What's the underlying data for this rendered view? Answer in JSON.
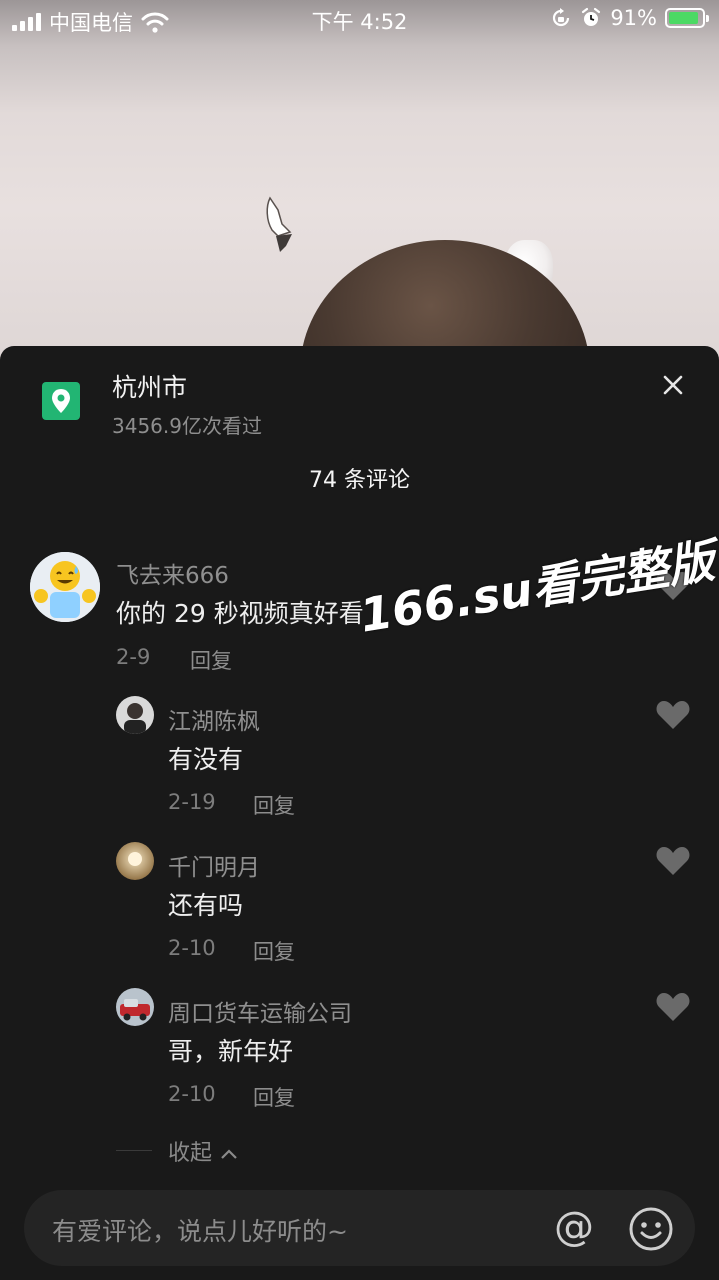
{
  "status_bar": {
    "carrier": "中国电信",
    "time": "下午 4:52",
    "battery_percent": "91%",
    "battery_level": 0.91
  },
  "location": {
    "title": "杭州市",
    "views": "3456.9亿次看过"
  },
  "comment_count": "74 条评论",
  "comments": [
    {
      "username": "飞去来666",
      "text": "你的 29 秒视频真好看",
      "date": "2-9",
      "reply_label": "回复",
      "avatar": "emoji-avatar"
    },
    {
      "username": "江湖陈枫",
      "text": "有没有",
      "date": "2-19",
      "reply_label": "回复",
      "avatar": "man-avatar"
    },
    {
      "username": "千门明月",
      "text": "还有吗",
      "date": "2-10",
      "reply_label": "回复",
      "avatar": "warm-avatar"
    },
    {
      "username": "周口货车运输公司",
      "text": "哥，新年好",
      "date": "2-10",
      "reply_label": "回复",
      "avatar": "truck-avatar"
    }
  ],
  "collapse_label": "收起",
  "watermark": "166.su看完整版",
  "input": {
    "placeholder": "有爱评论，说点儿好听的~",
    "at_symbol": "@"
  },
  "colors": {
    "panel_bg": "#191919",
    "location_green": "#22b573",
    "battery_green": "#4cd964"
  }
}
